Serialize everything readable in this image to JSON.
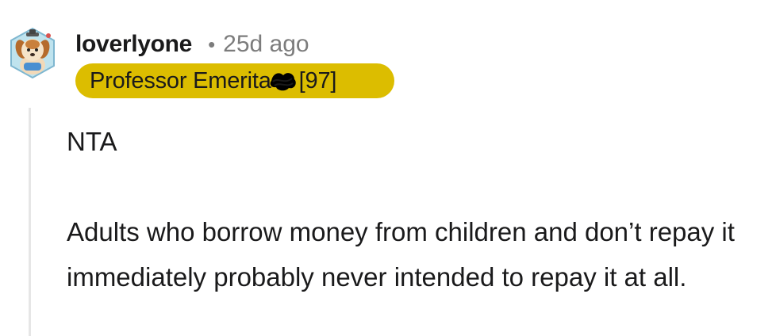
{
  "comment": {
    "username": "loverlyone",
    "separator": "•",
    "timestamp": "25d ago",
    "avatar_icon": "cartoon-dog-avatar-icon",
    "flair": {
      "text": "Professor Emerita",
      "emoji_icon": "redacted-scribble-icon",
      "count": "[97]",
      "background_color": "#dcbd00"
    },
    "body": {
      "paragraph_1": "NTA",
      "paragraph_2": "Adults who borrow money from children and don’t repay it immediately probably never intended to repay it at all."
    }
  }
}
